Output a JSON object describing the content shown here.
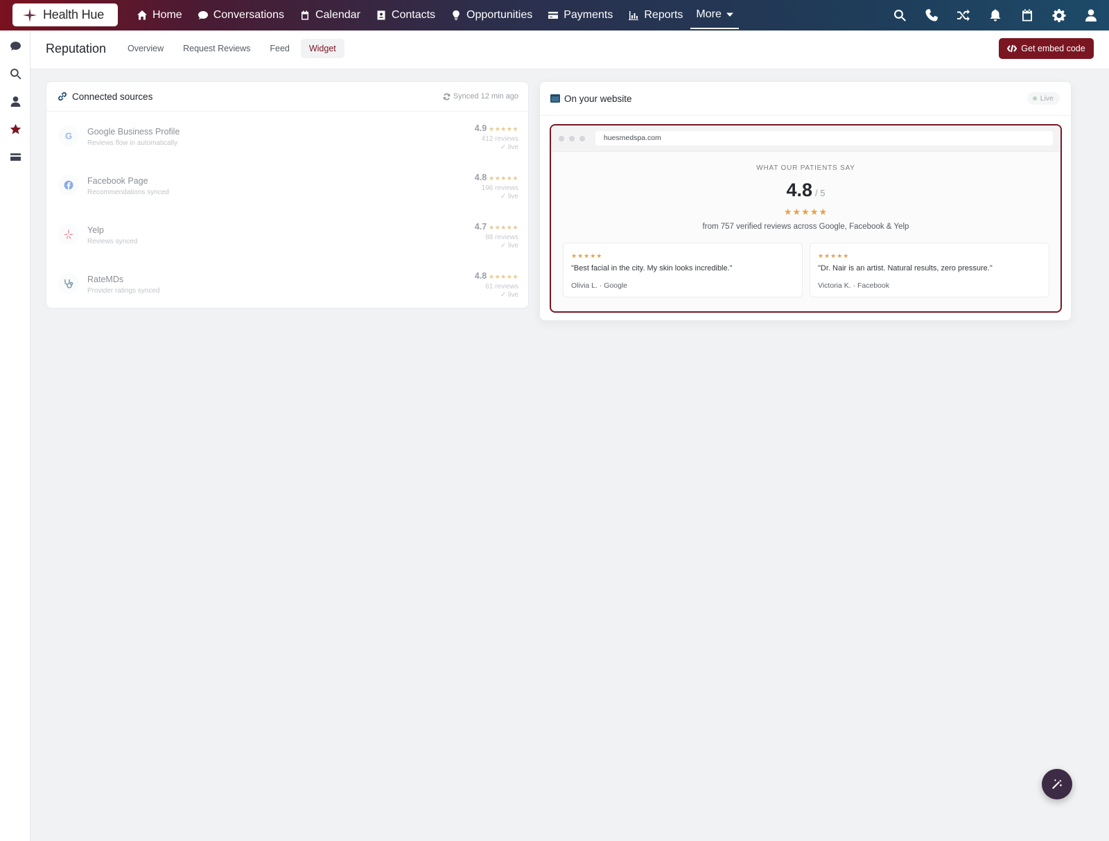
{
  "brand": {
    "name": "Health Hue",
    "accent": "#7a1622"
  },
  "topnav": {
    "items": [
      {
        "label": "Home",
        "icon": "home-icon"
      },
      {
        "label": "Conversations",
        "icon": "chat-icon"
      },
      {
        "label": "Calendar",
        "icon": "calendar-icon"
      },
      {
        "label": "Contacts",
        "icon": "contact-card-icon"
      },
      {
        "label": "Opportunities",
        "icon": "lightbulb-icon"
      },
      {
        "label": "Payments",
        "icon": "credit-card-icon"
      },
      {
        "label": "Reports",
        "icon": "bar-chart-icon"
      }
    ],
    "more_label": "More",
    "right_icons": [
      "search-icon",
      "phone-icon",
      "shuffle-icon",
      "bell-icon",
      "calendar-icon",
      "gear-icon",
      "user-icon"
    ]
  },
  "rail": {
    "icons": [
      "chat-icon",
      "search-icon",
      "user-icon",
      "star-icon",
      "credit-card-icon"
    ]
  },
  "subheader": {
    "title": "Reputation",
    "tabs": [
      "Overview",
      "Request Reviews",
      "Feed",
      "Widget"
    ],
    "active_tab": "Widget",
    "embed_button": "Get embed code"
  },
  "sources": {
    "title": "Connected sources",
    "synced": "Synced 12 min ago",
    "items": [
      {
        "name": "Google Business Profile",
        "sub": "Reviews flow in automatically",
        "score": "4.9",
        "stars": "★★★★★",
        "count": "412 reviews",
        "status": "live"
      },
      {
        "name": "Facebook Page",
        "sub": "Recommendations synced",
        "score": "4.8",
        "stars": "★★★★★",
        "count": "196 reviews",
        "status": "live"
      },
      {
        "name": "Yelp",
        "sub": "Reviews synced",
        "score": "4.7",
        "stars": "★★★★★",
        "count": "88 reviews",
        "status": "live"
      },
      {
        "name": "RateMDs",
        "sub": "Provider ratings synced",
        "score": "4.8",
        "stars": "★★★★★",
        "count": "61 reviews",
        "status": "live"
      }
    ]
  },
  "website": {
    "title": "On your website",
    "badge": "Live",
    "url": "huesmedspa.com",
    "eyebrow": "WHAT OUR PATIENTS SAY",
    "score": "4.8",
    "out_of": "/ 5",
    "stars": "★★★★★",
    "summary": "from 757 verified reviews across Google, Facebook & Yelp",
    "quotes": [
      {
        "stars": "★★★★★",
        "text": "\"Best facial in the city. My skin looks incredible.\"",
        "author": "Olivia L. · Google"
      },
      {
        "stars": "★★★★★",
        "text": "\"Dr. Nair is an artist. Natural results, zero pressure.\"",
        "author": "Victoria K. · Facebook"
      }
    ]
  }
}
